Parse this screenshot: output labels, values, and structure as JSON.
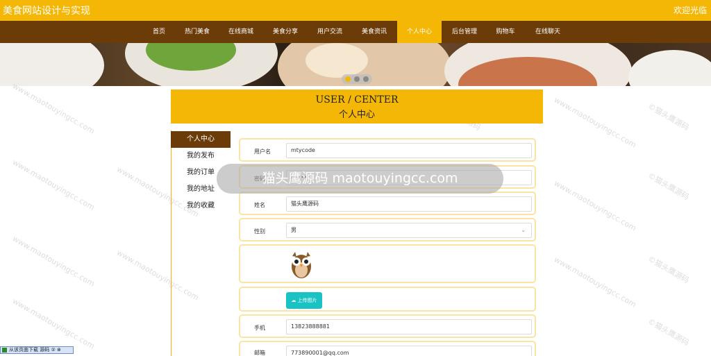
{
  "header": {
    "site_title": "美食网站设计与实现",
    "welcome": "欢迎光临"
  },
  "nav": {
    "items": [
      "首页",
      "热门美食",
      "在线商城",
      "美食分享",
      "用户交流",
      "美食资讯",
      "个人中心",
      "后台管理",
      "购物车",
      "在线聊天"
    ],
    "active": "个人中心"
  },
  "banner": {
    "carousel_total": 3,
    "carousel_active_index": 0
  },
  "user_center": {
    "title_en": "USER / CENTER",
    "title_cn": "个人中心"
  },
  "sidebar": {
    "items": [
      {
        "label": "个人中心"
      },
      {
        "label": "我的发布"
      },
      {
        "label": "我的订单"
      },
      {
        "label": "我的地址"
      },
      {
        "label": "我的收藏"
      }
    ]
  },
  "form": {
    "username": {
      "label": "用户名",
      "value": "mtycode"
    },
    "password": {
      "label": "密码",
      "value": "••••••"
    },
    "name": {
      "label": "姓名",
      "value": "猫头鹰源码"
    },
    "gender": {
      "label": "性别",
      "value": "男"
    },
    "upload_label": "上传图片",
    "phone": {
      "label": "手机",
      "value": "13823888881"
    },
    "email": {
      "label": "邮箱",
      "value": "773890001@qq.com"
    }
  },
  "watermark": {
    "banner_text": "猫头鹰源码 maotouyingcc.com",
    "text": "©猫头鹰源码",
    "url": "www.maotouyingcc.com"
  },
  "widget": {
    "label": "从该页面下载 源码 ② ⊗"
  },
  "colors": {
    "accent": "#f5b705",
    "nav_bg": "#6b3b08",
    "upload_btn": "#19c3c3",
    "row_border": "#fbe4a1"
  }
}
